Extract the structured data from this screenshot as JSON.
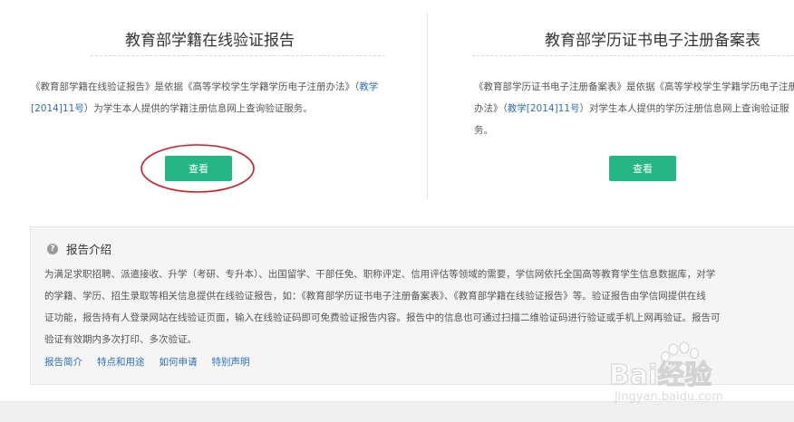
{
  "left_card": {
    "title": "教育部学籍在线验证报告",
    "desc_pre": "《教育部学籍在线验证报告》是依据《高等学校学生学籍学历电子注册办法》（",
    "desc_link": "教学[2014]11号",
    "desc_post": "）为学生本人提供的学籍注册信息网上查询验证服务。",
    "button": "查看"
  },
  "right_card": {
    "title": "教育部学历证书电子注册备案表",
    "desc_pre": "《教育部学历证书电子注册备案表》是依据《高等学校学生学籍学历电子注册办法》（",
    "desc_link": "教学[2014]11号",
    "desc_post": "）对学生本人提供的学历注册信息网上查询验证服务。",
    "button": "查看"
  },
  "intro": {
    "title": "报告介绍",
    "lines": [
      "为满足求职招聘、派遣接收、升学（考研、专升本）、出国留学、干部任免、职称评定、信用评估等领域的需要，学信网依托全国高等教育学生信息数据库，对学",
      "的学籍、学历、招生录取等相关信息提供在线验证报告，如：《教育部学历证书电子注册备案表》、《教育部学籍在线验证报告》等。验证报告由学信网提供在线",
      "证功能，报告持有人登录网站在线验证页面，输入在线验证码即可免费验证报告内容。报告中的信息也可通过扫描二维验证码进行验证或手机上网再验证。报告可",
      "验证有效期内多次打印、多次验证。"
    ],
    "links": [
      "报告简介",
      "特点和用途",
      "如何申请",
      "特别声明"
    ]
  },
  "watermark": {
    "brand": "Bai经验",
    "url": "jingyan.baidu.com"
  },
  "colors": {
    "button": "#26b585",
    "link": "#2e6fb8",
    "annotation": "#d9161e"
  }
}
